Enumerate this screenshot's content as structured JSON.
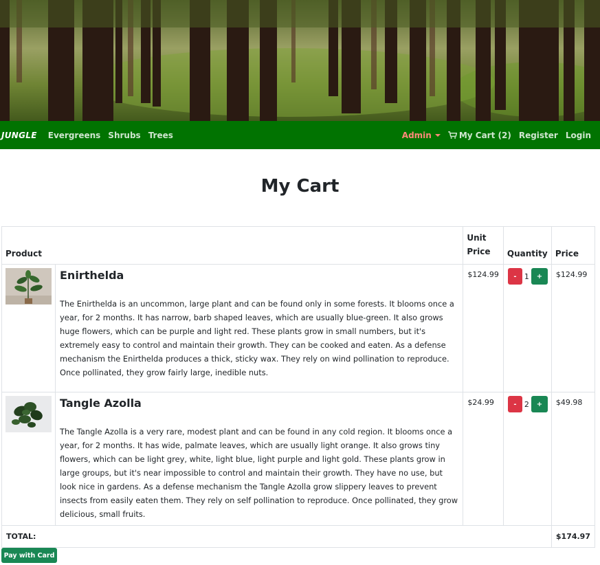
{
  "nav": {
    "brand": "JUNGLE",
    "links": [
      "Evergreens",
      "Shrubs",
      "Trees"
    ],
    "admin": "Admin",
    "cart": "My Cart (2)",
    "register": "Register",
    "login": "Login"
  },
  "page": {
    "title": "My Cart"
  },
  "table": {
    "headers": {
      "product": "Product",
      "unit_price": "Unit\nPrice",
      "quantity": "Quantity",
      "price": "Price"
    },
    "rows": [
      {
        "name": "Enirthelda",
        "description": "The Enirthelda is an uncommon, large plant and can be found only in some forests. It blooms once a year, for 2 months. It has narrow, barb shaped leaves, which are usually blue-green. It also grows huge flowers, which can be purple and light red. These plants grow in small numbers, but it's extremely easy to control and maintain their growth. They can be cooked and eaten. As a defense mechanism the Enirthelda produces a thick, sticky wax. They rely on wind pollination to reproduce. Once pollinated, they grow fairly large, inedible nuts.",
        "unit_price": "$124.99",
        "quantity": "1",
        "price": "$124.99"
      },
      {
        "name": "Tangle Azolla",
        "description": "The Tangle Azolla is a very rare, modest plant and can be found in any cold region. It blooms once a year, for 2 months. It has wide, palmate leaves, which are usually light orange. It also grows tiny flowers, which can be light grey, white, light blue, light purple and light gold. These plants grow in large groups, but it's near impossible to control and maintain their growth. They have no use, but look nice in gardens. As a defense mechanism the Tangle Azolla grow slippery leaves to prevent insects from easily eaten them. They rely on self pollination to reproduce. Once pollinated, they grow delicious, small fruits.",
        "unit_price": "$24.99",
        "quantity": "2",
        "price": "$49.98"
      }
    ],
    "minus_label": "-",
    "plus_label": "+",
    "total_label": "TOTAL:",
    "total_value": "$174.97"
  },
  "actions": {
    "pay": "Pay with Card"
  },
  "colors": {
    "navbar": "#017301",
    "minus": "#dc3545",
    "plus": "#198754",
    "admin": "#ff8a7a"
  },
  "icons": {
    "cart": "shopping-cart-icon",
    "admin_caret": "caret-down-icon"
  }
}
